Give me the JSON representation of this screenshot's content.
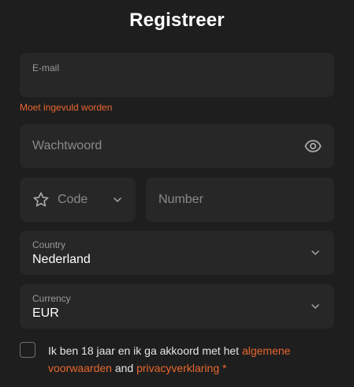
{
  "page": {
    "title": "Registreer"
  },
  "email": {
    "label": "E-mail",
    "value": "",
    "error": "Moet ingevuld worden"
  },
  "password": {
    "placeholder": "Wachtwoord",
    "icon": "eye-icon"
  },
  "phone": {
    "code_placeholder": "Code",
    "code_icon": "star-icon",
    "number_placeholder": "Number"
  },
  "country": {
    "label": "Country",
    "value": "Nederland"
  },
  "currency": {
    "label": "Currency",
    "value": "EUR"
  },
  "terms": {
    "text_before": "Ik ben 18 jaar en ik ga akkoord met het ",
    "terms_link": "algemene voorwaarden",
    "text_middle": " and ",
    "privacy_link": "privacyverklaring",
    "required_mark": " *"
  },
  "colors": {
    "background": "#1e1e1e",
    "field": "#272727",
    "accent": "#e8672f"
  }
}
